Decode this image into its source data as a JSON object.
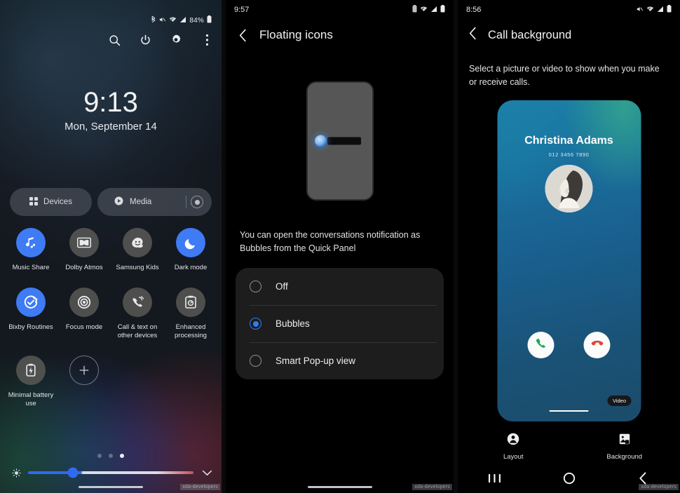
{
  "panels": {
    "quick_panel": {
      "name": "Quick panel",
      "status_bar": {
        "bluetooth": "bluetooth-icon",
        "mute": "mute-icon",
        "wifi": "wifi-icon",
        "signal": "signal-icon",
        "battery_text": "84%",
        "battery": "battery-icon"
      },
      "actions": [
        {
          "name": "search-icon",
          "label": "Search"
        },
        {
          "name": "power-icon",
          "label": "Power"
        },
        {
          "name": "settings-icon",
          "label": "Settings"
        },
        {
          "name": "more-icon",
          "label": "More options"
        }
      ],
      "clock": "9:13",
      "date": "Mon, September 14",
      "pills": [
        {
          "label": "Devices",
          "icon": "devices-grid-icon"
        },
        {
          "label": "Media",
          "icon": "play-icon",
          "cast": "cast-icon"
        }
      ],
      "tiles": [
        {
          "label": "Music Share",
          "icon": "music-share-icon",
          "state": "on"
        },
        {
          "label": "Dolby Atmos",
          "icon": "dolby-atmos-icon",
          "state": "off"
        },
        {
          "label": "Samsung Kids",
          "icon": "samsung-kids-icon",
          "state": "off"
        },
        {
          "label": "Dark mode",
          "icon": "moon-icon",
          "state": "on"
        },
        {
          "label": "Bixby Routines",
          "icon": "bixby-routines-icon",
          "state": "on"
        },
        {
          "label": "Focus mode",
          "icon": "focus-mode-icon",
          "state": "off"
        },
        {
          "label": "Call & text on other devices",
          "icon": "call-text-other-devices-icon",
          "state": "off"
        },
        {
          "label": "Enhanced processing",
          "icon": "enhanced-processing-icon",
          "state": "off"
        },
        {
          "label": "Minimal battery use",
          "icon": "minimal-battery-icon",
          "state": "off"
        },
        {
          "label": "",
          "icon": "add-tile-icon",
          "state": "add"
        }
      ],
      "page_dots": {
        "count": 3,
        "active_index": 2
      },
      "brightness": {
        "icon": "brightness-icon",
        "value_percent": 27,
        "expand": "chevron-down-icon"
      },
      "watermark": "xda-developers"
    },
    "floating_icons": {
      "status_bar": {
        "time": "9:57",
        "icons": [
          "battery-saver-icon",
          "wifi-icon",
          "signal-icon",
          "battery-icon"
        ]
      },
      "back": "back-arrow-icon",
      "title": "Floating icons",
      "illustration": "phone-bubble-illustration",
      "description": "You can open the conversations notification as Bubbles from the Quick Panel",
      "options": [
        {
          "label": "Off",
          "selected": false
        },
        {
          "label": "Bubbles",
          "selected": true
        },
        {
          "label": "Smart Pop-up view",
          "selected": false
        }
      ],
      "watermark": "xda-developers"
    },
    "call_background": {
      "status_bar": {
        "time": "8:56",
        "icons": [
          "mute-icon",
          "wifi-icon",
          "signal-icon",
          "battery-icon"
        ]
      },
      "back": "back-arrow-icon",
      "title": "Call background",
      "description": "Select a picture or video to show when you make or receive calls.",
      "preview": {
        "contact_name": "Christina Adams",
        "contact_number": "012 3456 7890",
        "avatar": "contact-avatar",
        "accept": "accept-call-icon",
        "decline": "decline-call-icon",
        "video_label": "Video"
      },
      "tools": [
        {
          "label": "Layout",
          "icon": "layout-icon"
        },
        {
          "label": "Background",
          "icon": "background-image-icon"
        }
      ],
      "nav": [
        {
          "name": "recents-button",
          "icon": "recents-icon"
        },
        {
          "name": "home-button",
          "icon": "home-icon"
        },
        {
          "name": "back-button",
          "icon": "back-nav-icon"
        }
      ],
      "watermark": "xda-developers"
    }
  },
  "colors": {
    "accent": "#3e7bf5",
    "radio_accent": "#2f7df6",
    "accept": "#1faa58",
    "decline": "#e0433a"
  }
}
